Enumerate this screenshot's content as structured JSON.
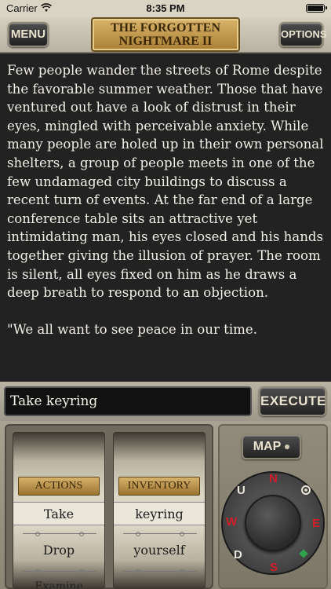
{
  "status_bar": {
    "carrier": "Carrier",
    "time": "8:35 PM"
  },
  "header": {
    "menu_label": "MENU",
    "title_line1": "THE FORGOTTEN",
    "title_line2": "NIGHTMARE II",
    "options_label": "OPTIONS"
  },
  "story": {
    "paragraphs": [
      "Few people wander the streets of Rome despite the favorable summer weather. Those that have ventured out have a look of distrust in their eyes, mingled with perceivable anxiety. While many people are holed up in their own personal shelters, a group of people meets in one of the few undamaged city buildings to discuss a recent turn of events. At the far end of a large conference table sits an attractive yet intimidating man, his eyes closed and his hands together giving the illusion of prayer. The room is silent, all eyes fixed on him as he draws a deep breath to respond to an objection.",
      "\"We all want to see peace in our time."
    ]
  },
  "command": {
    "value": "Take keyring",
    "execute_label": "EXECUTE"
  },
  "actions_wheel": {
    "label": "ACTIONS",
    "items": [
      "Take",
      "Drop",
      "Examine"
    ]
  },
  "inventory_wheel": {
    "label": "INVENTORY",
    "items": [
      "keyring",
      "yourself"
    ]
  },
  "navigation": {
    "map_label": "MAP",
    "directions": {
      "n": "N",
      "e": "E",
      "s": "S",
      "w": "W",
      "u": "U",
      "d": "D"
    },
    "icons": [
      "wifi-icon",
      "battery-icon",
      "look-icon"
    ]
  },
  "colors": {
    "direction_red": "#d21e2a",
    "plaque_gold": "#c49a4c",
    "story_bg": "#222222"
  }
}
